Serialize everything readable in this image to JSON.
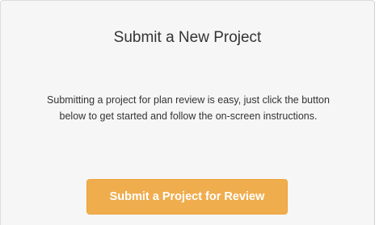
{
  "card": {
    "title": "Submit a New Project",
    "description": "Submitting a project for plan review is easy, just click the button below to get started and follow the on-screen instructions.",
    "button_label": "Submit a Project for Review"
  },
  "colors": {
    "card_background": "#f6f6f6",
    "card_border": "#dcdcdc",
    "button_background": "#f0ad4e",
    "button_text": "#ffffff",
    "text": "#333333"
  }
}
